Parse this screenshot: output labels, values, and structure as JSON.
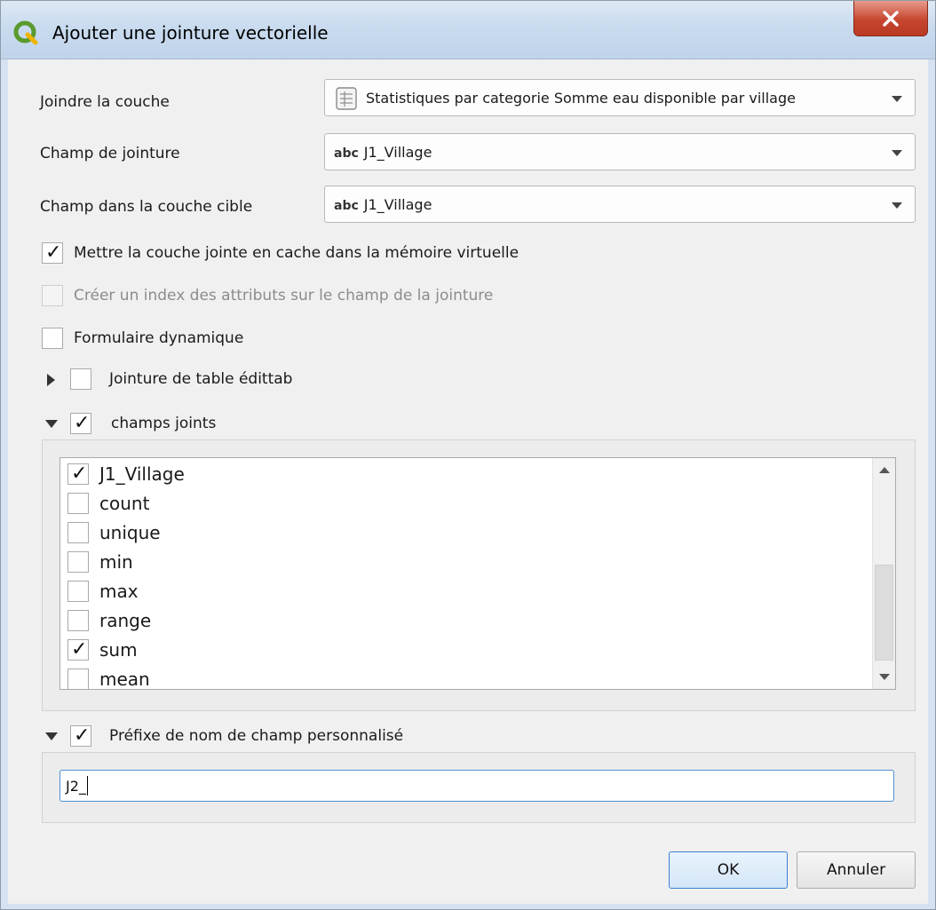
{
  "window": {
    "title": "Ajouter une jointure vectorielle",
    "close_label": "X"
  },
  "form": {
    "join_layer": {
      "label": "Joindre la couche",
      "value": "Statistiques par categorie Somme eau disponible par village"
    },
    "join_field": {
      "label": "Champ de jointure",
      "type_badge": "abc",
      "value": "J1_Village"
    },
    "target_field": {
      "label": "Champ dans la couche cible",
      "type_badge": "abc",
      "value": "J1_Village"
    }
  },
  "options": {
    "cache": {
      "label": "Mettre la couche jointe en cache dans la mémoire virtuelle",
      "checked": true
    },
    "index": {
      "label": "Créer un index des attributs sur le champ de la jointure",
      "checked": false,
      "disabled": true
    },
    "dynamic_form": {
      "label": "Formulaire dynamique",
      "checked": false
    },
    "editable": {
      "label": "Jointure de table édittab",
      "checked": false,
      "expanded": false
    },
    "joined_fields": {
      "label": "champs joints",
      "checked": true,
      "expanded": true
    },
    "custom_prefix": {
      "label": "Préfixe de nom de champ personnalisé",
      "checked": true,
      "expanded": true
    }
  },
  "fields_list": [
    {
      "name": "J1_Village",
      "checked": true
    },
    {
      "name": "count",
      "checked": false
    },
    {
      "name": "unique",
      "checked": false
    },
    {
      "name": "min",
      "checked": false
    },
    {
      "name": "max",
      "checked": false
    },
    {
      "name": "range",
      "checked": false
    },
    {
      "name": "sum",
      "checked": true
    },
    {
      "name": "mean",
      "checked": false
    }
  ],
  "prefix": {
    "value": "J2_"
  },
  "buttons": {
    "ok": "OK",
    "cancel": "Annuler"
  },
  "check_mark": "✓",
  "colors": {
    "accent": "#4d8fd6",
    "close": "#c7452f",
    "qgis_green": "#5b9a2e"
  }
}
